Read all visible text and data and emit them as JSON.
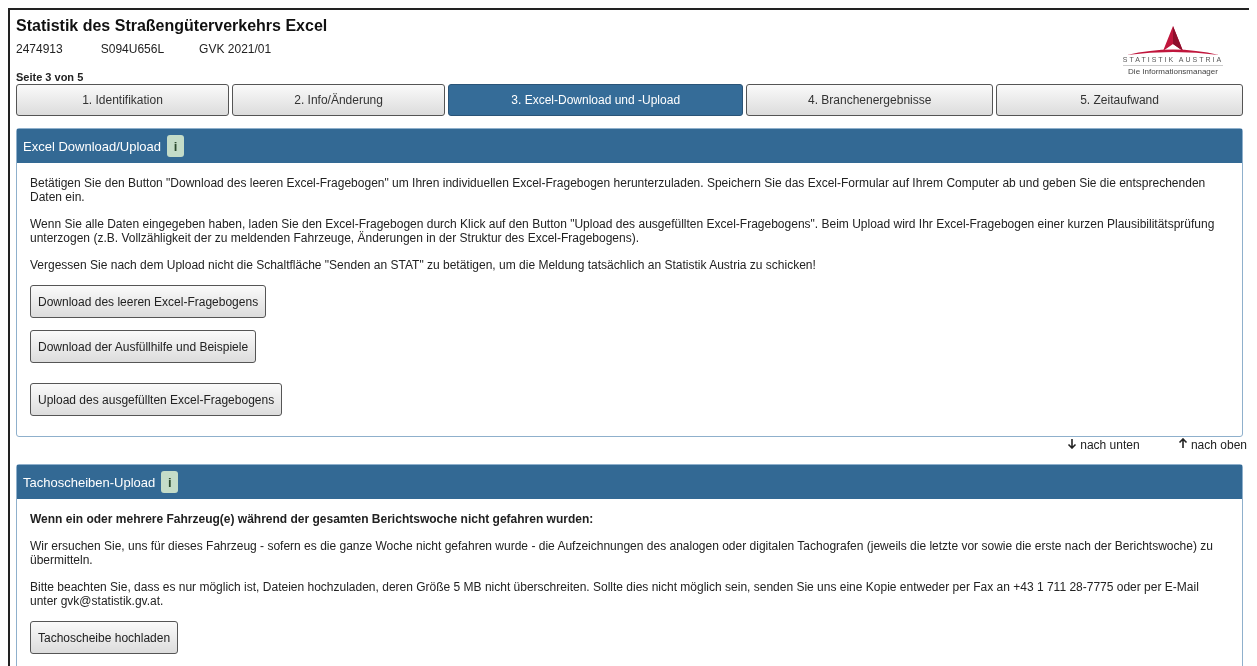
{
  "header": {
    "title": "Statistik des Straßengüterverkehrs Excel",
    "meta": [
      "2474913",
      "S094U656L",
      "GVK 2021/01"
    ],
    "page_indicator": "Seite 3 von 5"
  },
  "logo": {
    "name": "STATISTIK AUSTRIA",
    "tagline": "Die Informationsmanager"
  },
  "tabs": [
    {
      "label": "1. Identifikation",
      "selected": false
    },
    {
      "label": "2. Info/Änderung",
      "selected": false
    },
    {
      "label": "3. Excel-Download und -Upload",
      "selected": true
    },
    {
      "label": "4. Branchenergebnisse",
      "selected": false
    },
    {
      "label": "5. Zeitaufwand",
      "selected": false
    }
  ],
  "sections": [
    {
      "title": "Excel Download/Upload",
      "info": "i",
      "paragraphs": [
        {
          "kind": "text",
          "text": "Betätigen Sie den Button \"Download des leeren Excel-Fragebogen\" um Ihren individuellen Excel-Fragebogen herunterzuladen. Speichern Sie das Excel-Formular auf Ihrem Computer ab und geben Sie die entsprechenden Daten ein."
        },
        {
          "kind": "text",
          "text": "Wenn Sie alle Daten eingegeben haben, laden Sie den Excel-Fragebogen durch Klick auf den Button \"Upload des ausgefüllten Excel-Fragebogens\". Beim Upload wird Ihr Excel-Fragebogen einer kurzen Plausibilitätsprüfung unterzogen (z.B. Vollzähligkeit der zu meldenden Fahrzeuge, Änderungen in der Struktur des Excel-Fragebogens)."
        },
        {
          "kind": "text",
          "text": "Vergessen Sie nach dem Upload nicht die Schaltfläche \"Senden an STAT\" zu betätigen, um die Meldung tatsächlich an Statistik Austria zu schicken!"
        }
      ],
      "button_groups": [
        [
          "Download des leeren Excel-Fragebogens",
          "Download der Ausfüllhilfe und Beispiele"
        ],
        [
          "Upload des ausgefüllten Excel-Fragebogens"
        ]
      ],
      "nav_links": [
        {
          "kind": "down",
          "label": "nach unten"
        },
        {
          "kind": "up",
          "label": "nach oben"
        }
      ]
    },
    {
      "title": "Tachoscheiben-Upload",
      "info": "i",
      "paragraphs": [
        {
          "kind": "bold",
          "text": "Wenn ein oder mehrere Fahrzeug(e) während der gesamten Berichtswoche nicht gefahren wurden:"
        },
        {
          "kind": "text",
          "text": "Wir ersuchen Sie, uns für dieses Fahrzeug - sofern es die ganze Woche nicht gefahren wurde - die Aufzeichnungen des analogen oder digitalen Tachografen (jeweils die letzte vor sowie die erste nach der Berichtswoche) zu übermitteln."
        },
        {
          "kind": "text",
          "text": "Bitte beachten Sie, dass es nur möglich ist, Dateien hochzuladen, deren Größe 5 MB nicht überschreiten. Sollte dies nicht möglich sein, senden Sie uns eine Kopie entweder per Fax an +43 1 711 28-7775 oder per E-Mail unter gvk@statistik.gv.at."
        }
      ],
      "button_groups": [
        [
          "Tachoscheibe hochladen"
        ]
      ]
    }
  ]
}
